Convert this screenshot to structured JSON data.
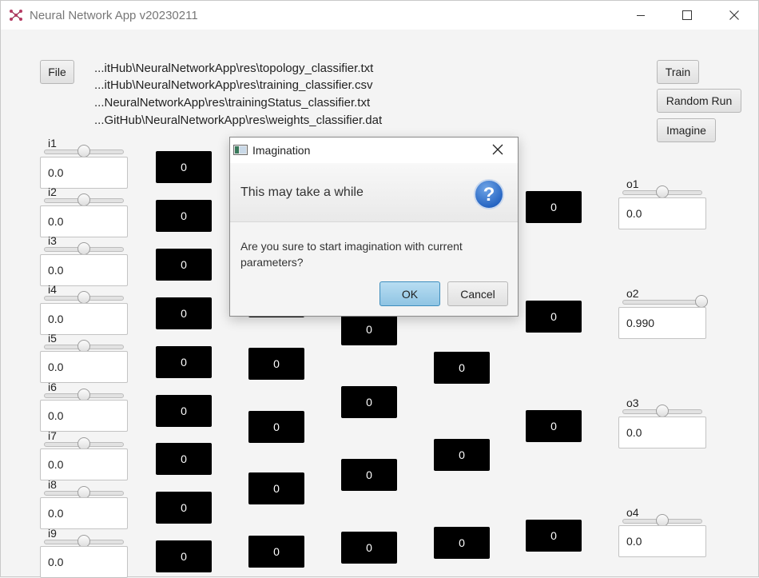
{
  "window": {
    "title": "Neural Network App v20230211"
  },
  "toolbar": {
    "file_label": "File",
    "train_label": "Train",
    "random_run_label": "Random Run",
    "imagine_label": "Imagine"
  },
  "paths": [
    "...itHub\\NeuralNetworkApp\\res\\topology_classifier.txt",
    "...itHub\\NeuralNetworkApp\\res\\training_classifier.csv",
    "...NeuralNetworkApp\\res\\trainingStatus_classifier.txt",
    "...GitHub\\NeuralNetworkApp\\res\\weights_classifier.dat"
  ],
  "inputs": [
    {
      "label": "i1",
      "value": "0.0",
      "slider_fraction": 0.5
    },
    {
      "label": "i2",
      "value": "0.0",
      "slider_fraction": 0.5
    },
    {
      "label": "i3",
      "value": "0.0",
      "slider_fraction": 0.5
    },
    {
      "label": "i4",
      "value": "0.0",
      "slider_fraction": 0.5
    },
    {
      "label": "i5",
      "value": "0.0",
      "slider_fraction": 0.5
    },
    {
      "label": "i6",
      "value": "0.0",
      "slider_fraction": 0.5
    },
    {
      "label": "i7",
      "value": "0.0",
      "slider_fraction": 0.5
    },
    {
      "label": "i8",
      "value": "0.0",
      "slider_fraction": 0.5
    },
    {
      "label": "i9",
      "value": "0.0",
      "slider_fraction": 0.5
    }
  ],
  "outputs": [
    {
      "label": "o1",
      "value": "0.0",
      "slider_fraction": 0.5
    },
    {
      "label": "o2",
      "value": "0.990",
      "slider_fraction": 0.99
    },
    {
      "label": "o3",
      "value": "0.0",
      "slider_fraction": 0.5
    },
    {
      "label": "o4",
      "value": "0.0",
      "slider_fraction": 0.5
    }
  ],
  "layers": [
    {
      "neurons": [
        "0",
        "0",
        "0",
        "0",
        "0",
        "0",
        "0",
        "0",
        "0"
      ]
    },
    {
      "neurons": [
        "0",
        "0",
        "0",
        "0"
      ]
    },
    {
      "neurons": [
        "0",
        "0",
        "0",
        "0",
        "0"
      ]
    },
    {
      "neurons": [
        "0",
        "0",
        "0",
        "0"
      ]
    },
    {
      "neurons": [
        "0",
        "0",
        "0",
        "0"
      ]
    }
  ],
  "dialog": {
    "title": "Imagination",
    "header": "This may take a while",
    "content": "Are you sure to start imagination with current parameters?",
    "ok_label": "OK",
    "cancel_label": "Cancel"
  }
}
